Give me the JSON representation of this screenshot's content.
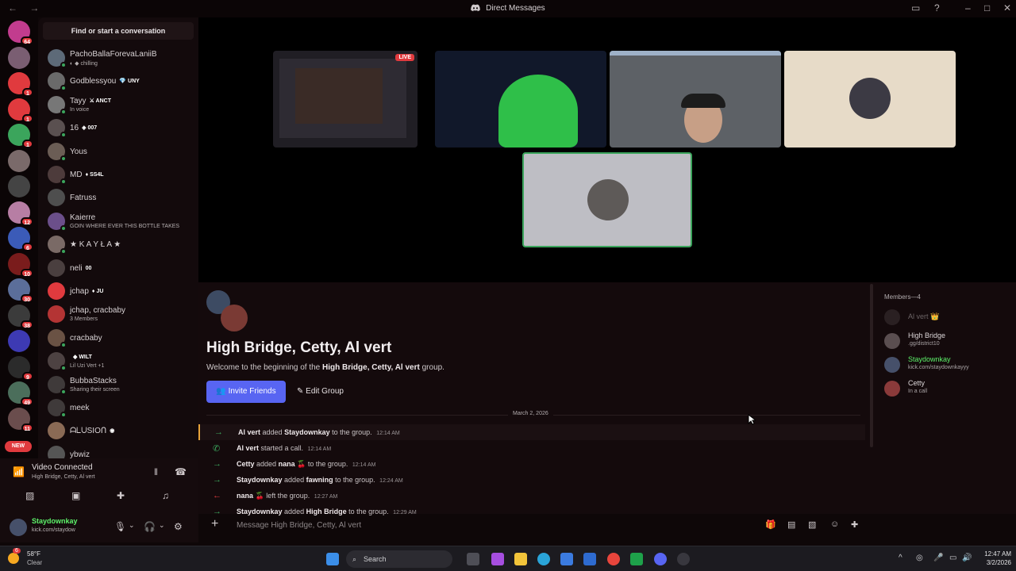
{
  "window": {
    "title": "Direct Messages",
    "nav": "← →"
  },
  "sidebar": {
    "find_label": "Find or start a conversation",
    "new_label": "NEW",
    "servers": [
      {
        "badge": "64",
        "color": "#c23c8e"
      },
      {
        "badge": "",
        "color": "#7a5e72"
      },
      {
        "badge": "1",
        "color": "#e03a3e"
      },
      {
        "badge": "1",
        "color": "#e03a3e"
      },
      {
        "badge": "1",
        "color": "#3ba55c"
      },
      {
        "badge": "",
        "color": "#7a6a6a"
      },
      {
        "badge": "",
        "color": "#444"
      },
      {
        "badge": "12",
        "color": "#b77ea4"
      },
      {
        "badge": "6",
        "color": "#3b5bb8"
      },
      {
        "badge": "10",
        "color": "#7a1c1c"
      },
      {
        "badge": "30",
        "color": "#5b6e9a"
      },
      {
        "badge": "38",
        "color": "#3b3b3b"
      },
      {
        "badge": "",
        "color": "#3d3ab3"
      },
      {
        "badge": "9",
        "color": "#2b2b2b"
      },
      {
        "badge": "49",
        "color": "#4b6e5b"
      },
      {
        "badge": "11",
        "color": "#6a4d4d"
      }
    ],
    "dms": [
      {
        "name": "PachoBallaForevaLaniiB",
        "tag": "",
        "sub": "◐ ◆ chilling",
        "color": "#5d6a78",
        "status": "#3ba55c"
      },
      {
        "name": "Godblessyou",
        "tag": "💎 UNY",
        "sub": "",
        "color": "#6a6a6a",
        "status": "#3ba55c"
      },
      {
        "name": "Tayy",
        "tag": "⚔ ANCT",
        "sub": "In voice",
        "color": "#777",
        "status": "#3ba55c"
      },
      {
        "name": "16",
        "tag": "◈ 007",
        "sub": "",
        "color": "#5a5050",
        "status": "#3ba55c"
      },
      {
        "name": "Yous",
        "tag": "",
        "sub": "",
        "color": "#6b5d55",
        "status": "#3ba55c"
      },
      {
        "name": "MD",
        "tag": "♦ SS4L",
        "sub": "",
        "color": "#4d3b3b",
        "status": "#3ba55c"
      },
      {
        "name": "Fatruss",
        "tag": "",
        "sub": "",
        "color": "#4e4e4e",
        "status": ""
      },
      {
        "name": "Kaierre",
        "tag": "",
        "sub": "GOIN WHERE EVER THIS BOTTLE TAKES",
        "color": "#6b4f8a",
        "status": "#3ba55c"
      },
      {
        "name": "★ K A Y Ł A ★",
        "tag": "",
        "sub": "",
        "color": "#7a6a66",
        "status": "#3ba55c"
      },
      {
        "name": "neli",
        "tag": "00",
        "sub": "",
        "color": "#4a3f3f",
        "status": ""
      },
      {
        "name": "jchap",
        "tag": "♦ JU",
        "sub": "",
        "color": "#e03a3e",
        "status": ""
      },
      {
        "name": "jchap, cracbaby",
        "tag": "",
        "sub": "3 Members",
        "color": "#b43434",
        "status": ""
      },
      {
        "name": "cracbaby",
        "tag": "",
        "sub": "",
        "color": "#6a5244",
        "status": "#3ba55c"
      },
      {
        "name": "",
        "tag": "◆ WILT",
        "sub": "Lil Uzi Vert +1",
        "color": "#4d4242",
        "status": "#3ba55c"
      },
      {
        "name": "BubbaStacks",
        "tag": "",
        "sub": "Sharing their screen",
        "color": "#3f3a3a",
        "status": "#3ba55c"
      },
      {
        "name": "meek",
        "tag": "",
        "sub": "",
        "color": "#3f3a3a",
        "status": "#3ba55c"
      },
      {
        "name": "ᗩᒪᑌSIOᑎ",
        "tag": "◉",
        "sub": "",
        "color": "#8a6a55",
        "status": ""
      },
      {
        "name": "ybwiz",
        "tag": "",
        "sub": "",
        "color": "#555",
        "status": ""
      }
    ]
  },
  "voice": {
    "status": "Video Connected",
    "channel": "High Bridge, Cetty, Al vert"
  },
  "user": {
    "name": "Staydownkay",
    "status": "kick.com/staydow"
  },
  "stage": {
    "live_label": "LIVE"
  },
  "group": {
    "title": "High Bridge, Cetty, Al vert",
    "welcome_prefix": "Welcome to the beginning of the",
    "welcome_name": "High Bridge, Cetty, Al vert",
    "welcome_suffix": "group.",
    "invite_label": "Invite Friends",
    "edit_label": "Edit Group"
  },
  "date_divider": "March 2, 2026",
  "messages": [
    {
      "actor": "Al vert",
      "action": "added",
      "target": "Staydownkay",
      "rest": "to the group.",
      "time": "12:14 AM",
      "kind": "join"
    },
    {
      "actor": "Al vert",
      "action": "started a call.",
      "target": "",
      "rest": "",
      "time": "12:14 AM",
      "kind": "call"
    },
    {
      "actor": "Cetty",
      "action": "added",
      "target": "nana 🍒",
      "rest": "to the group.",
      "time": "12:14 AM",
      "kind": "join"
    },
    {
      "actor": "Staydownkay",
      "action": "added",
      "target": "fawning",
      "rest": "to the group.",
      "time": "12:24 AM",
      "kind": "join"
    },
    {
      "actor": "nana 🍒",
      "action": "left the group.",
      "target": "",
      "rest": "",
      "time": "12:27 AM",
      "kind": "leave"
    },
    {
      "actor": "Staydownkay",
      "action": "added",
      "target": "High Bridge",
      "rest": "to the group.",
      "time": "12:29 AM",
      "kind": "join"
    }
  ],
  "composer": {
    "placeholder": "Message High Bridge, Cetty, Al vert"
  },
  "members": {
    "header": "Members—4",
    "list": [
      {
        "name": "Al vert 👑",
        "sub": "",
        "color": "#2a2022",
        "name_color": "#6c6466"
      },
      {
        "name": "High Bridge",
        "sub": ".gg/district10",
        "color": "#5a4e50",
        "name_color": "#ddd7d9"
      },
      {
        "name": "Staydownkay",
        "sub": "kick.com/staydownkayyy",
        "color": "#46506a",
        "name_color": "#5df26a"
      },
      {
        "name": "Cetty",
        "sub": "In a call",
        "color": "#8a3a3a",
        "name_color": "#ddd7d9"
      }
    ]
  },
  "taskbar": {
    "weather_temp": "58°F",
    "weather_desc": "Clear",
    "weather_badge": "6",
    "search_label": "Search",
    "time": "12:47 AM",
    "date": "3/2/2026"
  }
}
